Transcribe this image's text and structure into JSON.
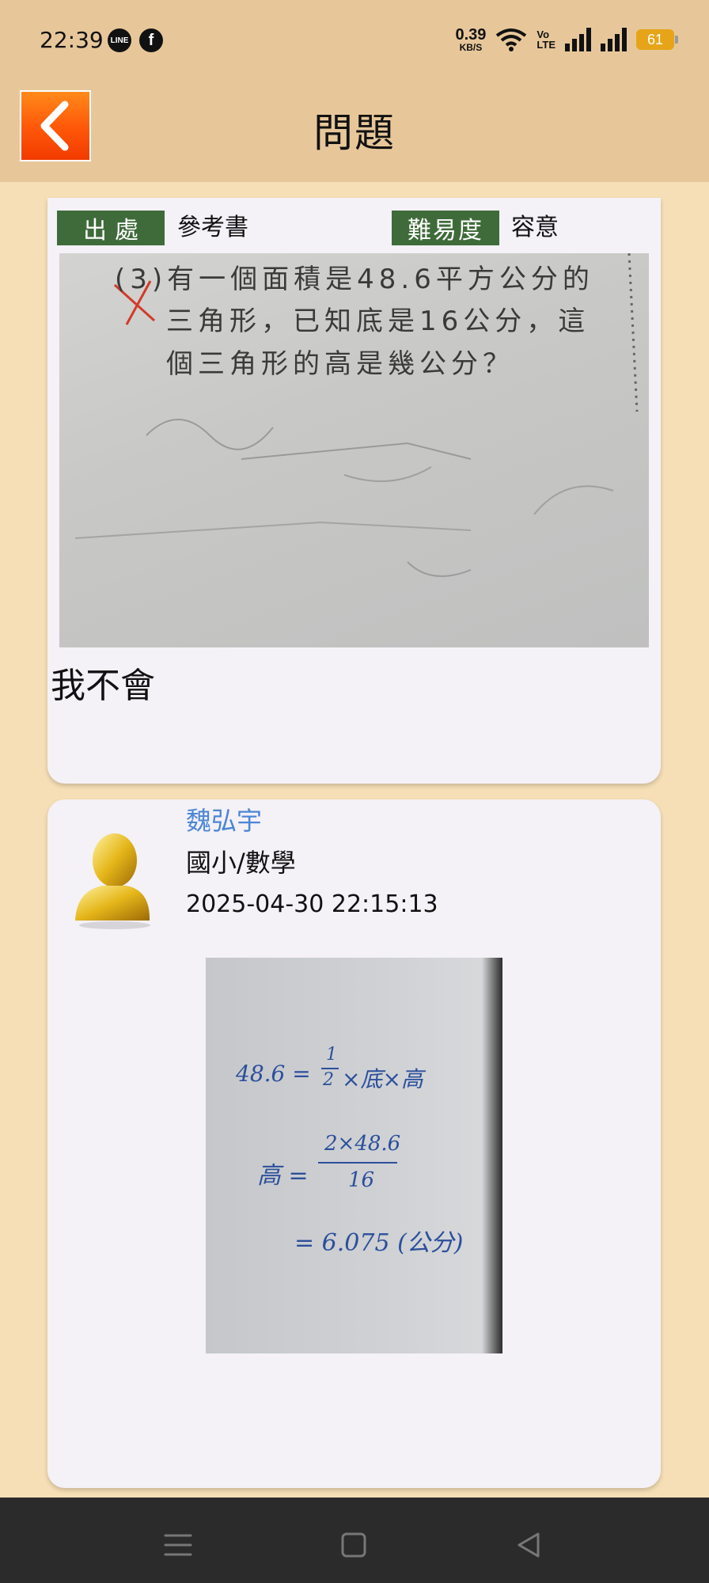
{
  "status_bar": {
    "time": "22:39",
    "app_icons": [
      "LINE",
      "f"
    ],
    "net_speed_value": "0.39",
    "net_speed_unit": "KB/S",
    "volte_top": "Vo",
    "volte_bottom": "LTE",
    "battery": "61"
  },
  "app_bar": {
    "title": "問題",
    "back_icon": "chevron-left-icon"
  },
  "question": {
    "source_label": "出處",
    "source_value": "參考書",
    "difficulty_label": "難易度",
    "difficulty_value": "容意",
    "photo_lines": [
      "(3)有一個面積是48.6平方公分的",
      "三角形，已知底是16公分，這",
      "個三角形的高是幾公分？"
    ],
    "note": "我不會"
  },
  "answer": {
    "author": "魏弘宇",
    "subject": "國小/數學",
    "timestamp": "2025-04-30 22:15:13",
    "photo_lines": {
      "line1_left": "48.6 =",
      "frac1_num": "1",
      "frac1_den": "2",
      "line1_right": "×底×高",
      "line2_left": "高 =",
      "frac2_num": "2×48.6",
      "frac2_den": "16",
      "line3": "= 6.075 (公分)"
    }
  },
  "nav_bar": {
    "icons": [
      "menu-icon",
      "home-square-icon",
      "back-triangle-icon"
    ]
  }
}
